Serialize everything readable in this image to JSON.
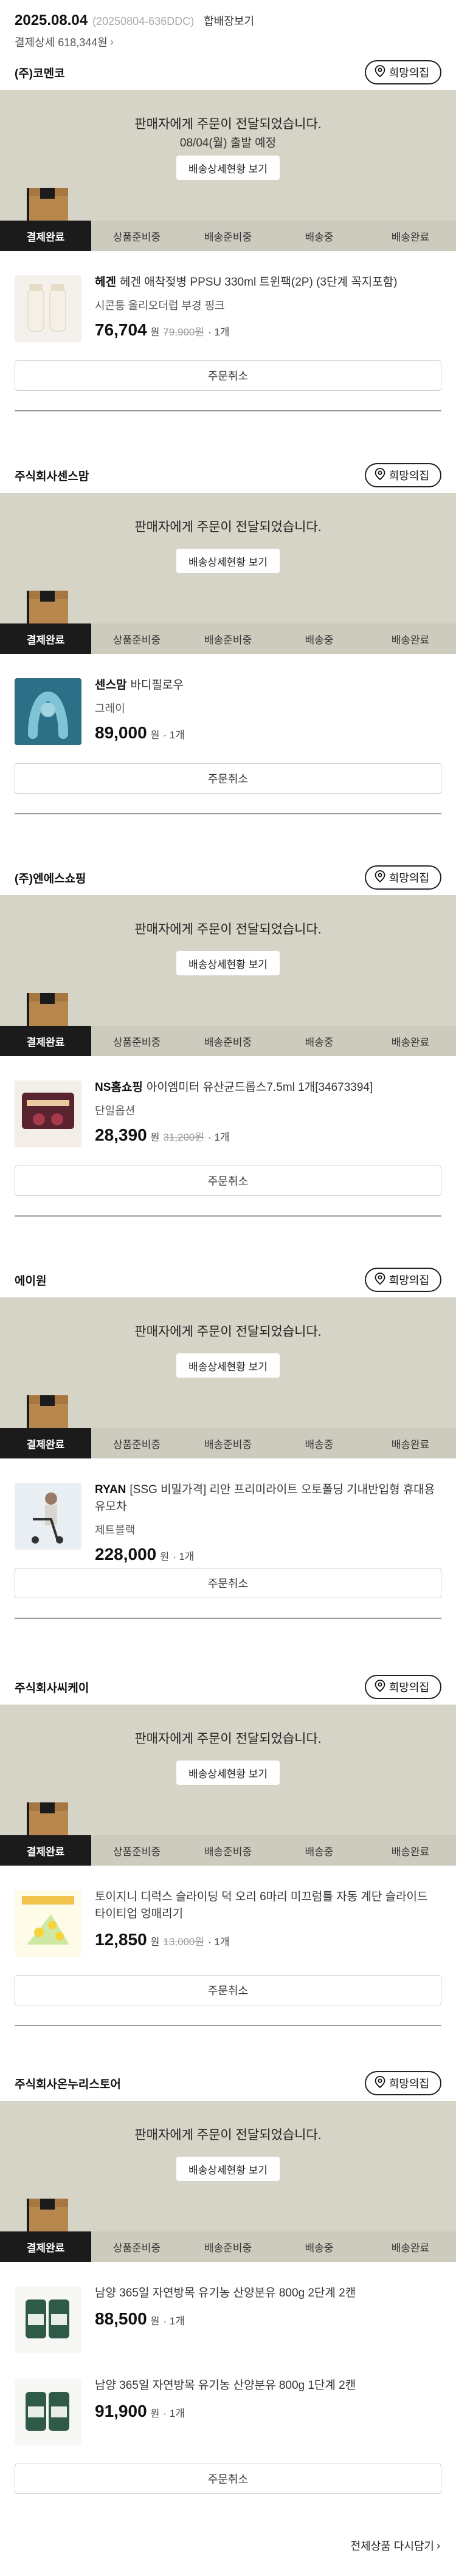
{
  "header": {
    "date": "2025.08.04",
    "order_no": "(20250804-636DDC)",
    "merge_label": "합배장보기",
    "detail_label": "결제상세 618,344원",
    "chevron": "›"
  },
  "common": {
    "wish_label": "희망의집",
    "status_message": "판매자에게 주문이 전달되었습니다.",
    "tracking_button": "배송상세현황 보기",
    "steps": [
      "결제완료",
      "상품준비중",
      "배송준비중",
      "배송중",
      "배송완료"
    ],
    "cancel_label": "주문취소",
    "price_unit": "원",
    "icons": {
      "wish": "location-pin-icon",
      "box": "package-box-icon",
      "chevron": "chevron-right-icon"
    },
    "colors": {
      "panel": "#d6d3c7",
      "active_step": "#1b1b1b"
    }
  },
  "shops": [
    {
      "seller": "(주)코멘코",
      "ship_notice": "08/04(월) 출발 예정",
      "items": [
        {
          "brand": "헤겐",
          "name": "헤겐 애착젖병 PPSU 330ml 트윈팩(2P) (3단계 꼭지포함)",
          "option": "시콘퉁 올리오더럽 부경 핑크",
          "price": "76,704",
          "original": "79,900원",
          "qty": "· 1개"
        }
      ]
    },
    {
      "seller": "주식회사센스맘",
      "ship_notice": "",
      "items": [
        {
          "brand": "센스맘",
          "name": "바디필로우",
          "option": "그레이",
          "price": "89,000",
          "original": "",
          "qty": "· 1개"
        }
      ]
    },
    {
      "seller": "(주)엔에스쇼핑",
      "ship_notice": "",
      "items": [
        {
          "brand": "NS홈쇼핑",
          "name": "아이엠미터 유산균드롭스7.5ml 1개[34673394]",
          "option": "단일옵션",
          "price": "28,390",
          "original": "31,200원",
          "qty": "· 1개"
        }
      ]
    },
    {
      "seller": "에이원",
      "ship_notice": "",
      "items": [
        {
          "brand": "RYAN",
          "name": "[SSG 비밀가격] 리안 프리미라이트 오토폴딩 기내반입형 휴대용 유모차",
          "option": "제트블랙",
          "price": "228,000",
          "original": "",
          "qty": "· 1개"
        }
      ]
    },
    {
      "seller": "주식회사씨케이",
      "ship_notice": "",
      "items": [
        {
          "brand": "",
          "name": "토이지니 디럭스 슬라이딩 덕 오리 6마리 미끄럼틀 자동 계단 슬라이드 타이티업 엉매리기",
          "option": "",
          "price": "12,850",
          "original": "13,000원",
          "qty": "· 1개"
        }
      ]
    },
    {
      "seller": "주식회사온누리스토어",
      "ship_notice": "",
      "items": [
        {
          "brand": "",
          "name": "남양 365일 자연방목 유기농 산양분유 800g 2단계 2캔",
          "option": "",
          "price": "88,500",
          "original": "",
          "qty": "· 1개"
        },
        {
          "brand": "",
          "name": "남양 365일 자연방목 유기농 산양분유 800g 1단계 2캔",
          "option": "",
          "price": "91,900",
          "original": "",
          "qty": "· 1개"
        }
      ]
    }
  ],
  "footer": {
    "reorder_label": "전체상품 다시담기",
    "chevron": "›"
  }
}
